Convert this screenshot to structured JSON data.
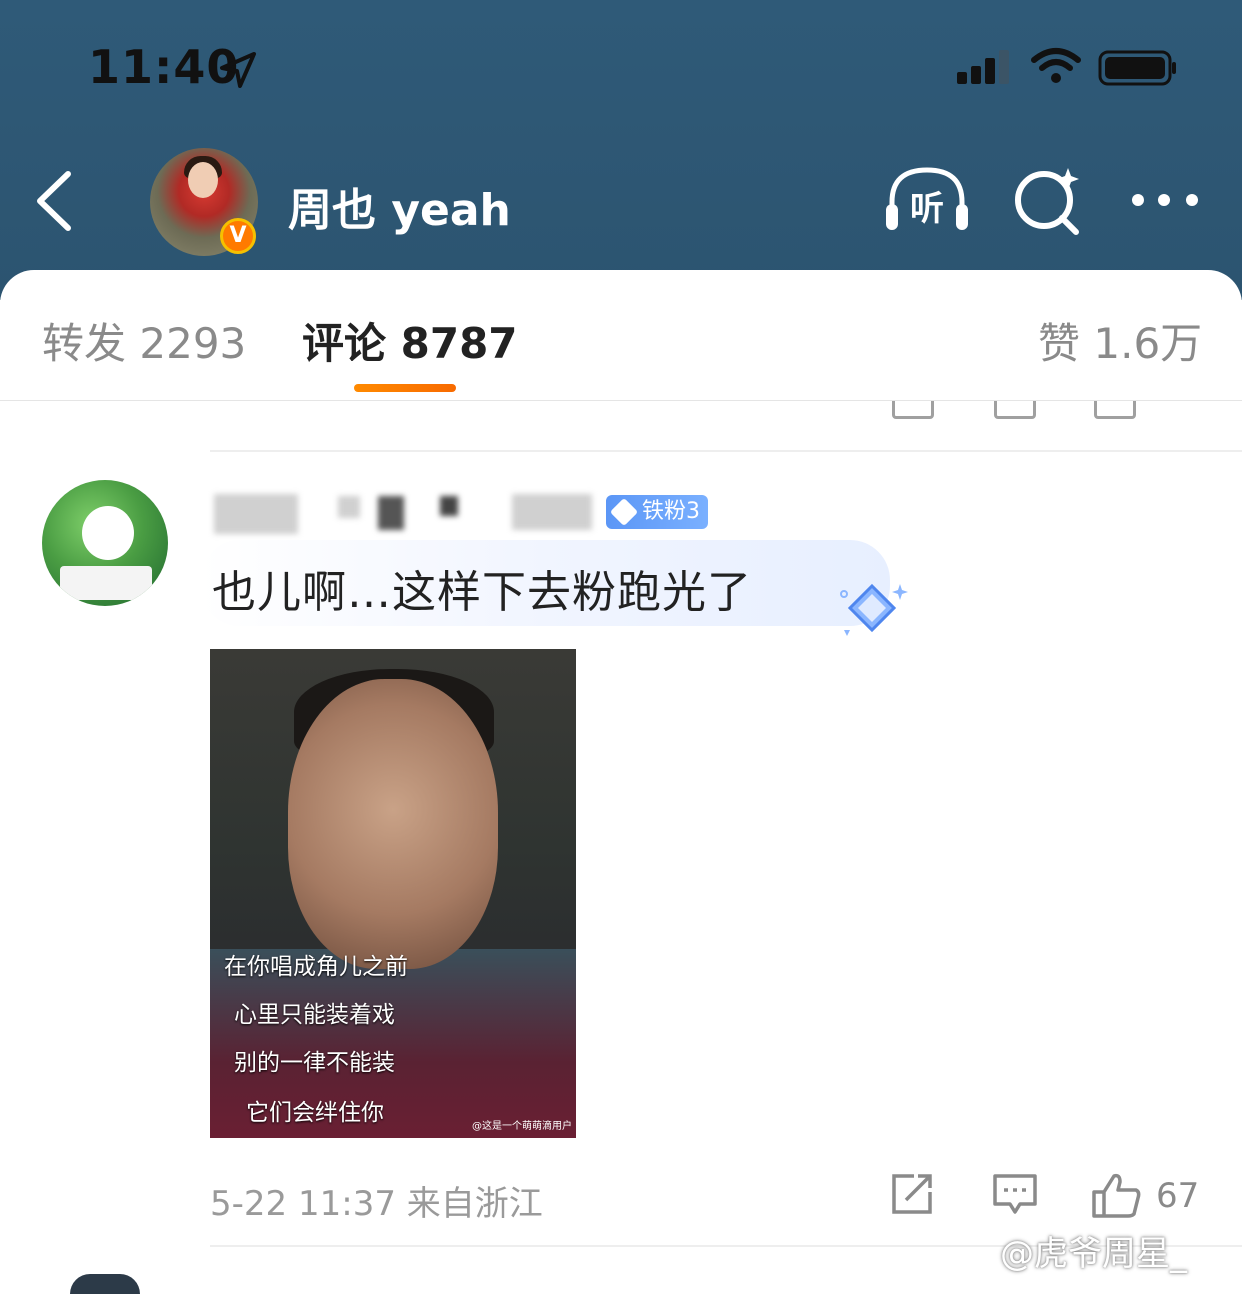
{
  "status_bar": {
    "time": "11:40"
  },
  "nav": {
    "title": "周也 yeah",
    "listen_label": "听",
    "verified_badge": "V"
  },
  "tabs": [
    {
      "label": "转发",
      "count": "2293"
    },
    {
      "label": "评论",
      "count": "8787"
    },
    {
      "label": "赞",
      "count": "1.6万"
    }
  ],
  "comment": {
    "fan_badge": "铁粉3",
    "text": "也儿啊…这样下去粉跑光了",
    "image_caption": [
      "在你唱成角儿之前",
      "心里只能装着戏",
      "别的一律不能装",
      "它们会绊住你"
    ],
    "image_watermark": "@这是一个萌萌滴用户",
    "meta": "5-22 11:37 来自浙江",
    "likes": "67"
  },
  "watermark": "@虎爷周星_",
  "colors": {
    "header_bg": "#2f5a78",
    "tab_indicator": "#ff8a00",
    "fan_badge": "#5b96f6"
  }
}
